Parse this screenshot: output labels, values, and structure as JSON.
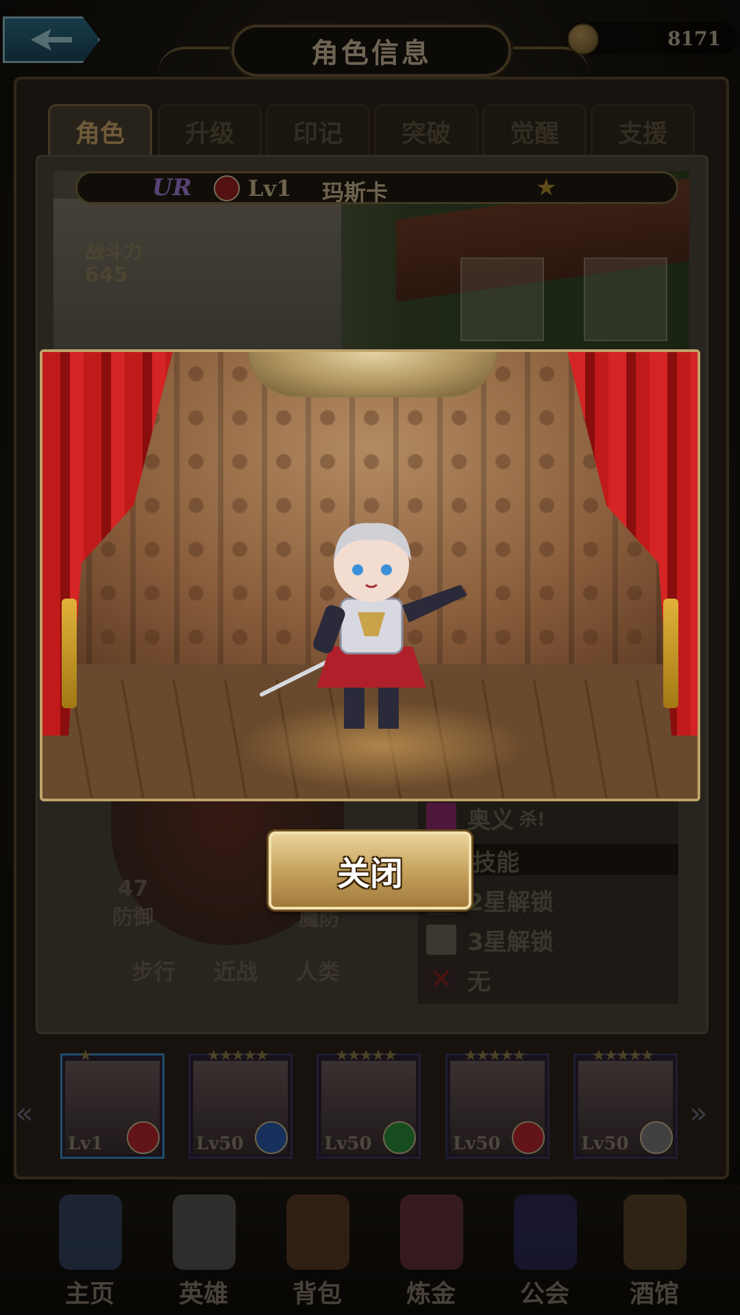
{
  "header": {
    "title": "角色信息",
    "currency_value": "8171",
    "back_icon": "back-arrow-icon",
    "currency_icon": "coin-icon"
  },
  "tabs": [
    {
      "label": "角色",
      "active": true
    },
    {
      "label": "升级",
      "active": false
    },
    {
      "label": "印记",
      "active": false
    },
    {
      "label": "突破",
      "active": false
    },
    {
      "label": "觉醒",
      "active": false
    },
    {
      "label": "支援",
      "active": false
    }
  ],
  "hero": {
    "rarity": "UR",
    "level": "Lv1",
    "name": "玛斯卡",
    "stars": 1,
    "power_label": "战斗力",
    "power_value": "645"
  },
  "stats": {
    "defense_value": "47",
    "defense_label": "防御",
    "mdef_label": "魔防"
  },
  "traits": [
    "步行",
    "近战",
    "人类"
  ],
  "skills": {
    "ultimate": "奥义",
    "ultimate_sub": "杀!",
    "header": "技能",
    "unlock2": "2星解锁",
    "unlock3": "3星解锁",
    "none": "无"
  },
  "roster": [
    {
      "level": "Lv1",
      "stars": "★",
      "selected": true,
      "badge_color": "#b3262a"
    },
    {
      "level": "Lv50",
      "stars": "★★★★★",
      "selected": false,
      "badge_color": "#2a5aa8"
    },
    {
      "level": "Lv50",
      "stars": "★★★★★",
      "selected": false,
      "badge_color": "#2a8a3a"
    },
    {
      "level": "Lv50",
      "stars": "★★★★★",
      "selected": false,
      "badge_color": "#b3262a"
    },
    {
      "level": "Lv50",
      "stars": "★★★★★",
      "selected": false,
      "badge_color": "#777777"
    }
  ],
  "nav": [
    "主页",
    "英雄",
    "背包",
    "炼金",
    "公会",
    "酒馆"
  ],
  "popup": {
    "close_label": "关闭"
  },
  "colors": {
    "accent_gold": "#c7a45f",
    "curtain_red": "#c11a1a"
  }
}
